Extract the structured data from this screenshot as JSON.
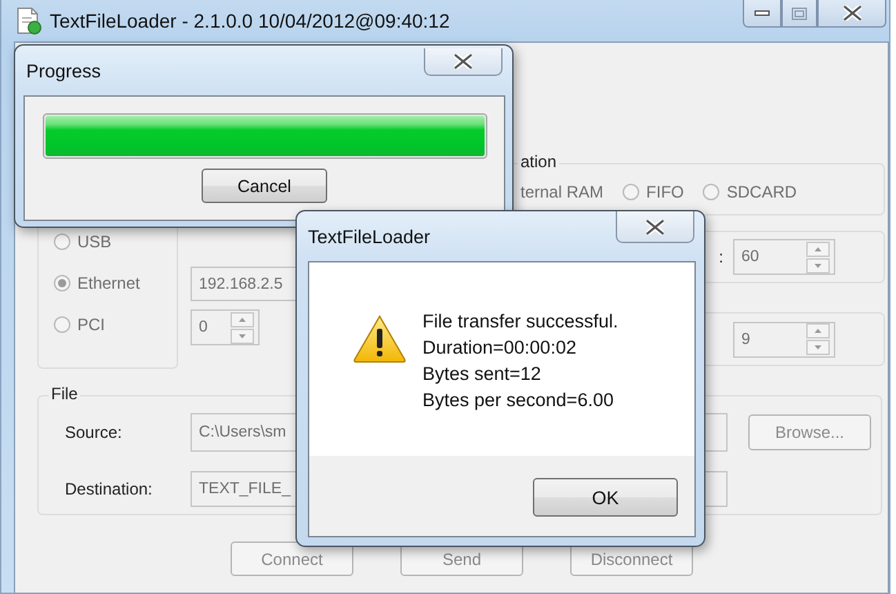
{
  "main_window": {
    "title": "TextFileLoader - 2.1.0.0 10/04/2012@09:40:12",
    "memory_group": {
      "label": "ation",
      "options": [
        {
          "label": "ternal RAM"
        },
        {
          "label": "FIFO",
          "selected": false
        },
        {
          "label": "SDCARD",
          "selected": false
        }
      ]
    },
    "interface_options": [
      {
        "label": "USB",
        "selected": false
      },
      {
        "label": "Ethernet",
        "selected": true
      },
      {
        "label": "PCI",
        "selected": false
      }
    ],
    "ip_address": "192.168.2.5",
    "port_index": "0",
    "setting_1": {
      "label": ":",
      "value": "60"
    },
    "setting_2": {
      "value": "9"
    },
    "file_group": {
      "label": "File",
      "source_label": "Source:",
      "source": "C:\\Users\\sm",
      "browse": "Browse...",
      "destination_label": "Destination:",
      "destination": "TEXT_FILE_"
    },
    "buttons": [
      "Connect",
      "Send",
      "Disconnect"
    ]
  },
  "progress_dialog": {
    "title": "Progress",
    "level": 1,
    "button": "Cancel"
  },
  "message_dialog": {
    "title": "TextFileLoader",
    "lines": [
      "File transfer successful.",
      "Duration=00:00:02",
      "Bytes sent=12",
      "Bytes per second=6.00"
    ],
    "button": "OK"
  }
}
